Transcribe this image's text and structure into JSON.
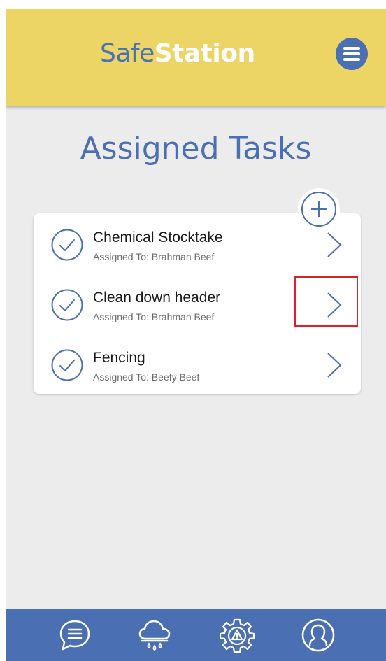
{
  "header": {
    "logo_part1": "Safe",
    "logo_part2": "Station",
    "menu_icon": "hamburger-menu-icon"
  },
  "page": {
    "title": "Assigned Tasks",
    "add_icon": "plus-icon"
  },
  "tasks": [
    {
      "title": "Chemical Stocktake",
      "assigned": "Assigned To: Brahman Beef",
      "status_icon": "check-circle-icon",
      "action_icon": "chevron-right-icon"
    },
    {
      "title": "Clean down header",
      "assigned": "Assigned To: Brahman Beef",
      "status_icon": "check-circle-icon",
      "action_icon": "chevron-right-icon",
      "highlighted": true
    },
    {
      "title": "Fencing",
      "assigned": "Assigned To: Beefy Beef",
      "status_icon": "check-circle-icon",
      "action_icon": "chevron-right-icon"
    }
  ],
  "footer_nav": [
    {
      "icon": "chat-bubble-icon"
    },
    {
      "icon": "rain-cloud-icon"
    },
    {
      "icon": "gear-warning-icon"
    },
    {
      "icon": "user-profile-icon"
    }
  ],
  "colors": {
    "header_bg": "#ecd465",
    "primary": "#4a6fb3",
    "page_bg": "#ececec",
    "highlight": "#d8232a"
  }
}
